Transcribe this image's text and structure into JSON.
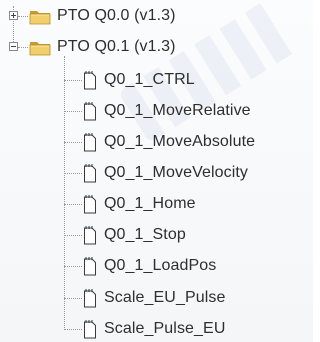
{
  "tree": {
    "folders": [
      {
        "label": "PTO Q0.0 (v1.3)",
        "expanded": false,
        "icon": "folder-icon"
      },
      {
        "label": "PTO Q0.1 (v1.3)",
        "expanded": true,
        "icon": "folder-icon",
        "children": [
          {
            "label": "Q0_1_CTRL",
            "icon": "subroutine-icon"
          },
          {
            "label": "Q0_1_MoveRelative",
            "icon": "subroutine-icon"
          },
          {
            "label": "Q0_1_MoveAbsolute",
            "icon": "subroutine-icon"
          },
          {
            "label": "Q0_1_MoveVelocity",
            "icon": "subroutine-icon"
          },
          {
            "label": "Q0_1_Home",
            "icon": "subroutine-icon"
          },
          {
            "label": "Q0_1_Stop",
            "icon": "subroutine-icon"
          },
          {
            "label": "Q0_1_LoadPos",
            "icon": "subroutine-icon"
          },
          {
            "label": "Scale_EU_Pulse",
            "icon": "subroutine-icon"
          },
          {
            "label": "Scale_Pulse_EU",
            "icon": "subroutine-icon"
          }
        ]
      }
    ]
  },
  "colors": {
    "folder": "#e8c25a",
    "folder_dark": "#c99a2e",
    "tree_line": "#9a9a9a",
    "text": "#2e2e2e"
  }
}
